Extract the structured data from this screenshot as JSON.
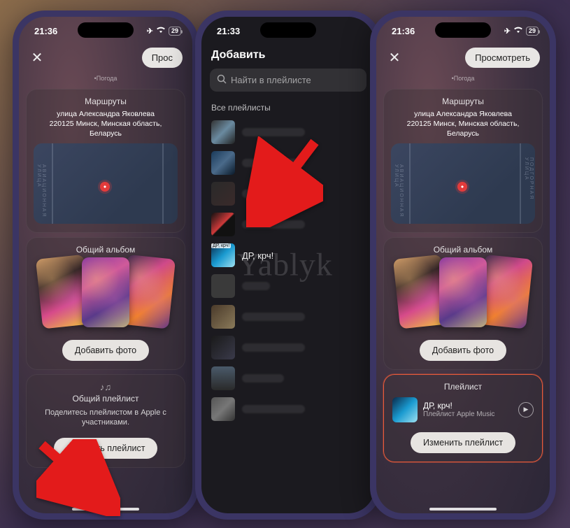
{
  "status": {
    "time1": "21:36",
    "time2": "21:33",
    "time3": "21:36",
    "battery": "29"
  },
  "phone2": {
    "title": "Добавить",
    "search_placeholder": "Найти в плейлисте",
    "section": "Все плейлисты",
    "highlight_label": "ДР, крч!",
    "highlight_tag": "ДР, крч!"
  },
  "common": {
    "preview_btn": "Просмотреть",
    "preview_btn_short": "Прос",
    "weather_tag": "•Погода",
    "routes_title": "Маршруты",
    "address_line1": "улица Александра Яковлева",
    "address_line2": "220125 Минск, Минская область, Беларусь",
    "album_title": "Общий альбом",
    "add_photo": "Добавить фото"
  },
  "phone1": {
    "playlist_card_title": "Общий плейлист",
    "playlist_desc": "Поделитесь плейлистом в Apple с участниками.",
    "add_playlist": "Добавить плейлист"
  },
  "phone3": {
    "playlist_label": "Плейлист",
    "pl_name": "ДР, крч!",
    "pl_sub": "Плейлист Apple Music",
    "change_playlist": "Изменить плейлист"
  },
  "watermark": "Yablyk"
}
